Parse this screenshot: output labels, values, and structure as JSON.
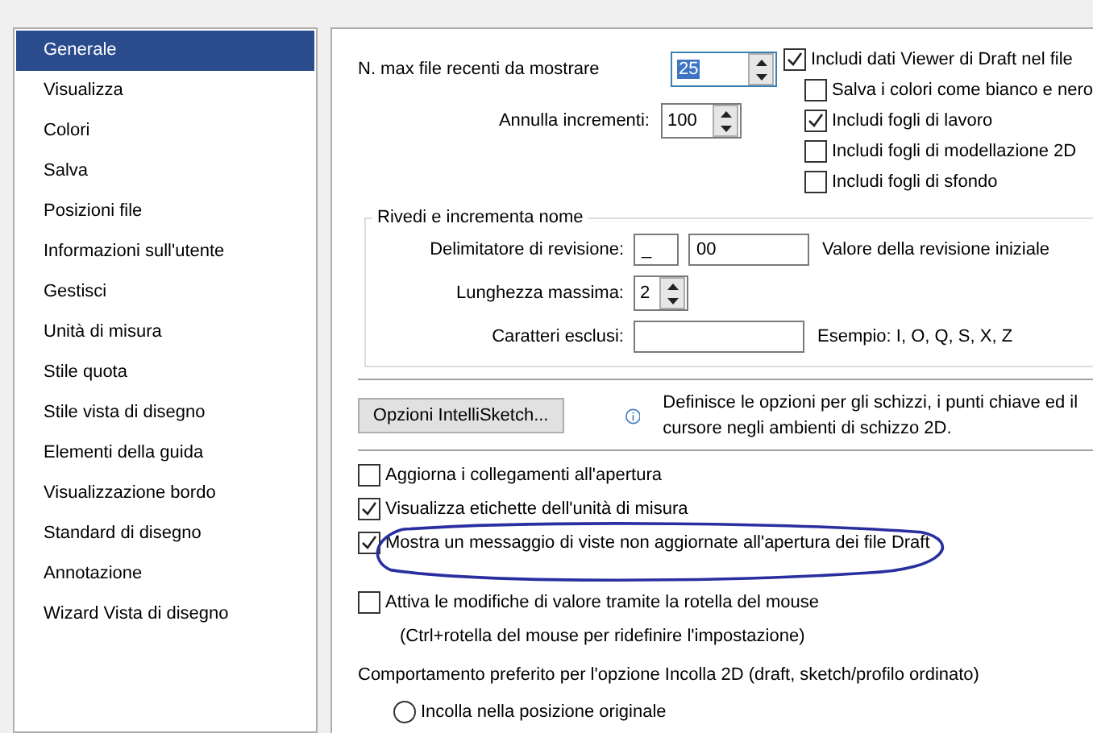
{
  "sidebar": {
    "items": [
      {
        "label": "Generale",
        "selected": true
      },
      {
        "label": "Visualizza",
        "selected": false
      },
      {
        "label": "Colori",
        "selected": false
      },
      {
        "label": "Salva",
        "selected": false
      },
      {
        "label": "Posizioni file",
        "selected": false
      },
      {
        "label": "Informazioni sull'utente",
        "selected": false
      },
      {
        "label": "Gestisci",
        "selected": false
      },
      {
        "label": "Unità di misura",
        "selected": false
      },
      {
        "label": "Stile quota",
        "selected": false
      },
      {
        "label": "Stile vista di disegno",
        "selected": false
      },
      {
        "label": "Elementi della guida",
        "selected": false
      },
      {
        "label": "Visualizzazione bordo",
        "selected": false
      },
      {
        "label": "Standard di disegno",
        "selected": false
      },
      {
        "label": "Annotazione",
        "selected": false
      },
      {
        "label": "Wizard Vista di disegno",
        "selected": false
      }
    ]
  },
  "recent_files": {
    "label": "N. max file recenti da mostrare",
    "value": "25"
  },
  "undo_steps": {
    "label": "Annulla incrementi:",
    "value": "100"
  },
  "include_options": [
    {
      "label": "Includi dati Viewer di Draft nel file",
      "checked": true,
      "indent": false
    },
    {
      "label": "Salva i colori come bianco e nero",
      "checked": false,
      "indent": true
    },
    {
      "label": "Includi fogli di lavoro",
      "checked": true,
      "indent": true
    },
    {
      "label": "Includi fogli di modellazione 2D",
      "checked": false,
      "indent": true
    },
    {
      "label": "Includi fogli di sfondo",
      "checked": false,
      "indent": true
    }
  ],
  "revision_group": {
    "title": "Rivedi e incrementa nome",
    "delimiter": {
      "label": "Delimitatore di revisione:",
      "value": "_",
      "initial": "00",
      "note": "Valore della revisione iniziale"
    },
    "max_length": {
      "label": "Lunghezza massima:",
      "value": "2"
    },
    "excluded": {
      "label": "Caratteri esclusi:",
      "note": "Esempio: I, O, Q, S, X, Z"
    }
  },
  "intellisketch": {
    "button": "Opzioni IntelliSketch...",
    "info": "Definisce le opzioni per gli schizzi, i punti chiave ed il cursore negli ambienti di schizzo 2D."
  },
  "options": [
    {
      "label": "Aggiorna i collegamenti all'apertura",
      "checked": false,
      "circled": false
    },
    {
      "label": "Visualizza etichette dell'unità di misura",
      "checked": true,
      "circled": false
    },
    {
      "label": "Mostra un messaggio di viste non aggiornate all'apertura dei file Draft",
      "checked": true,
      "circled": true
    },
    {
      "label": "Attiva le modifiche di valore tramite la rotella del mouse",
      "checked": false,
      "circled": false,
      "hint": "(Ctrl+rotella del mouse per ridefinire l'impostazione)"
    }
  ],
  "paste_behavior": {
    "label": "Comportamento preferito per l'opzione Incolla 2D (draft, sketch/profilo ordinato)",
    "choices": [
      {
        "label": "Incolla nella posizione originale",
        "selected": false
      }
    ]
  }
}
